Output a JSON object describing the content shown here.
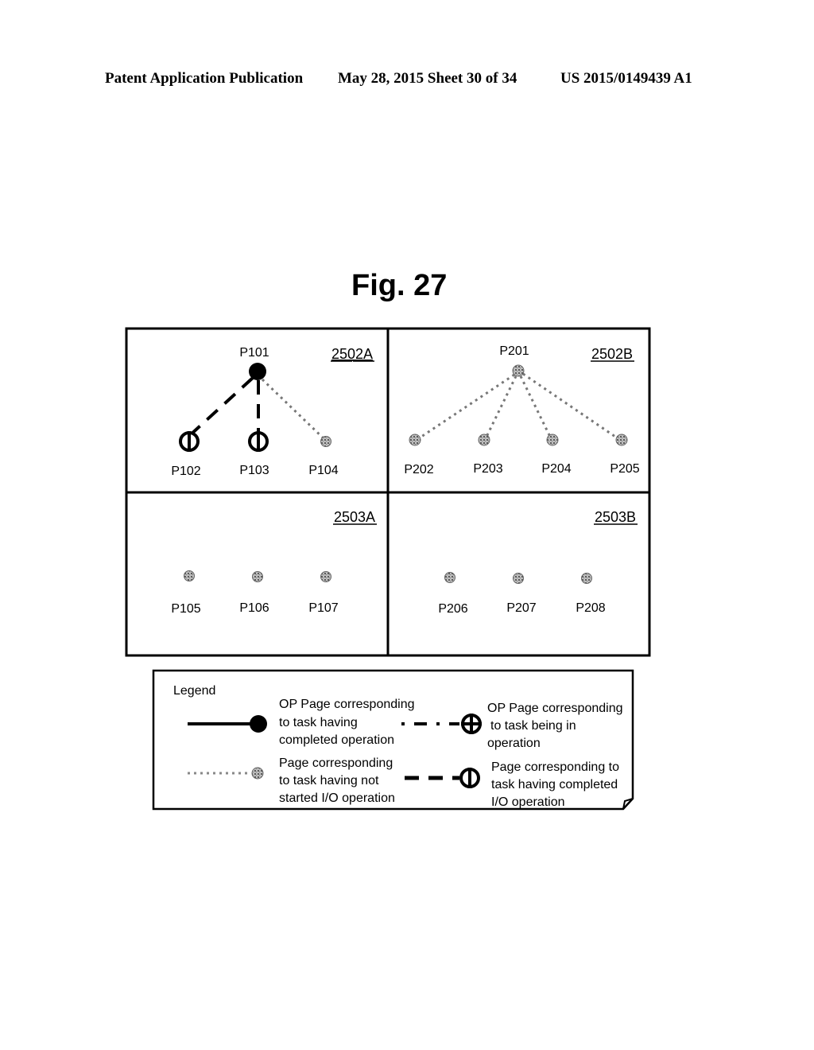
{
  "header": {
    "publication": "Patent Application Publication",
    "date_sheet": "May 28, 2015  Sheet 30 of 34",
    "number": "US 2015/0149439 A1"
  },
  "figure": {
    "title": "Fig. 27",
    "panels": {
      "p2502A": {
        "label": "2502A",
        "root": "P101",
        "children": [
          "P102",
          "P103",
          "P104"
        ],
        "child_types": [
          "io-completed",
          "io-completed",
          "not-started"
        ],
        "root_type": "completed"
      },
      "p2502B": {
        "label": "2502B",
        "root": "P201",
        "children": [
          "P202",
          "P203",
          "P204",
          "P205"
        ],
        "child_types": [
          "not-started",
          "not-started",
          "not-started",
          "not-started"
        ],
        "root_type": "not-started"
      },
      "p2503A": {
        "label": "2503A",
        "nodes": [
          "P105",
          "P106",
          "P107"
        ]
      },
      "p2503B": {
        "label": "2503B",
        "nodes": [
          "P206",
          "P207",
          "P208"
        ]
      }
    },
    "legend": {
      "title": "Legend",
      "items": [
        {
          "type": "completed",
          "lines": [
            "OP Page corresponding",
            "to task having",
            "completed operation"
          ]
        },
        {
          "type": "in-operation",
          "lines": [
            "OP Page corresponding",
            "to task being in",
            "operation"
          ]
        },
        {
          "type": "not-started",
          "lines": [
            "Page corresponding",
            "to task having not",
            "started I/O operation"
          ]
        },
        {
          "type": "io-completed",
          "lines": [
            "Page corresponding to",
            "task having completed",
            "I/O operation"
          ]
        }
      ]
    }
  }
}
